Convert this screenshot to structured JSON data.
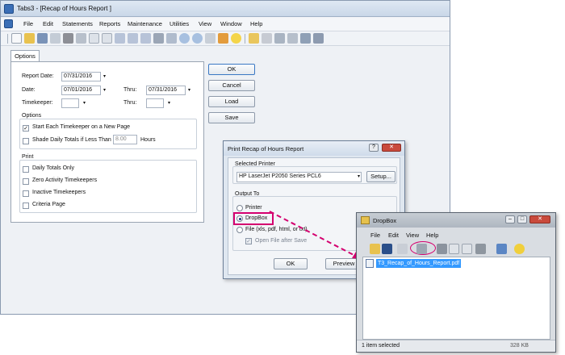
{
  "main_window": {
    "title": "Tabs3 - [Recap of Hours Report ]",
    "menu": [
      "File",
      "Edit",
      "Statements",
      "Reports",
      "Maintenance",
      "Utilities",
      "View",
      "Window",
      "Help"
    ]
  },
  "report_form": {
    "tab_label": "Options",
    "report_date_label": "Report Date:",
    "report_date_value": "07/31/2016",
    "date_label": "Date:",
    "date_from_value": "07/01/2016",
    "thru_label": "Thru:",
    "date_thru_value": "07/31/2016",
    "timekeeper_label": "Timekeeper:",
    "timekeeper_thru_label": "Thru:",
    "options_group_label": "Options",
    "start_each_timekeeper_label": "Start Each Timekeeper on a New Page",
    "start_each_timekeeper_checked": true,
    "shade_daily_label": "Shade Daily Totals if Less Than",
    "shade_daily_value": "8.00",
    "hours_label": "Hours",
    "print_group_label": "Print",
    "print_options": [
      {
        "label": "Daily Totals Only",
        "checked": false
      },
      {
        "label": "Zero Activity Timekeepers",
        "checked": false
      },
      {
        "label": "Inactive Timekeepers",
        "checked": false
      },
      {
        "label": "Criteria Page",
        "checked": false
      }
    ]
  },
  "side_buttons": {
    "ok": "OK",
    "cancel": "Cancel",
    "load": "Load",
    "save": "Save"
  },
  "print_dialog": {
    "title": "Print Recap of Hours Report",
    "selected_printer_label": "Selected Printer",
    "printer_value": "HP LaserJet P2050 Series PCL6",
    "setup_label": "Setup...",
    "output_to_label": "Output To",
    "output_options": [
      {
        "label": "Printer",
        "selected": false
      },
      {
        "label": "DropBox",
        "selected": true
      },
      {
        "label": "File (xls, pdf, html, or txt)",
        "selected": false
      }
    ],
    "open_after_save_label": "Open File after Save",
    "ok_label": "OK",
    "preview_label": "Preview"
  },
  "dropbox_window": {
    "title": "DropBox",
    "menu": [
      "File",
      "Edit",
      "View",
      "Help"
    ],
    "file_name": "T3_Recap_of_Hours_Report.pdf",
    "status_text": "1 item selected",
    "status_size": "328 KB"
  },
  "colors": {
    "highlight": "#d4006f",
    "selection": "#3399ff"
  }
}
